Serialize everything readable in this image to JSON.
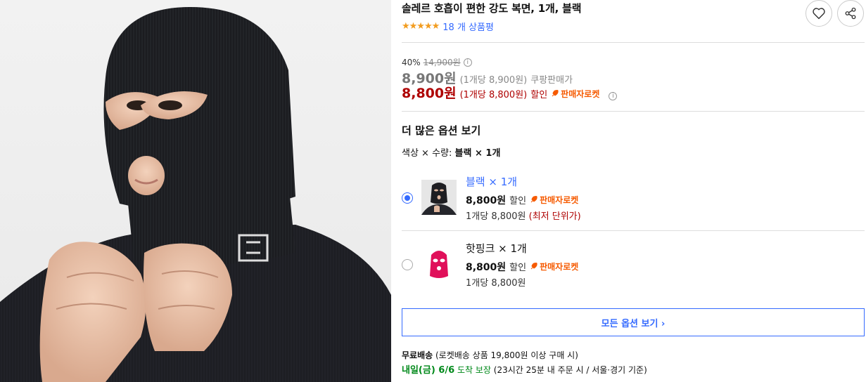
{
  "product": {
    "title": "솔레르 호흡이 편한 강도 복면, 1개, 블랙",
    "stars": "★★★★★",
    "review_count": "18 개 상품평",
    "rating": 5
  },
  "actions": {
    "wishlist_icon": "heart-icon",
    "share_icon": "share-icon"
  },
  "pricing": {
    "discount_rate": "40%",
    "original_price": "14,900원",
    "coupang_price": "8,900원",
    "coupang_unit": "(1개당 8,900원)",
    "coupang_label": "쿠팡판매가",
    "sale_price": "8,800원",
    "sale_unit": "(1개당 8,800원)",
    "sale_label": "할인",
    "rocket_label": "판매자로켓"
  },
  "options": {
    "section_title": "더 많은 옵션 보기",
    "summary_label": "색상 × 수량:",
    "summary_value": "블랙 × 1개",
    "items": [
      {
        "name": "블랙 × 1개",
        "price": "8,800원",
        "discount_label": "할인",
        "rocket_label": "판매자로켓",
        "unit_price": "1개당 8,800원",
        "unit_note": "(최저 단위가)",
        "selected": true,
        "color": "#1e1e22"
      },
      {
        "name": "핫핑크 × 1개",
        "price": "8,800원",
        "discount_label": "할인",
        "rocket_label": "판매자로켓",
        "unit_price": "1개당 8,800원",
        "unit_note": "",
        "selected": false,
        "color": "#e0105a"
      }
    ],
    "view_all_label": "모든 옵션 보기 ›"
  },
  "shipping": {
    "free_label": "무료배송",
    "free_note": "(로켓배송 상품 19,800원 이상 구매 시)",
    "arrival_day": "내일(금) 6/6",
    "arrival_suffix": "도착 보장",
    "arrival_note": "(23시간 25분 내 주문 시 / 서울·경기 기준)"
  },
  "colors": {
    "accent": "#346aff",
    "sale_red": "#ae0000",
    "rocket_orange": "#f65a00",
    "star": "#f29c1f",
    "delivery_green": "#00891a"
  }
}
